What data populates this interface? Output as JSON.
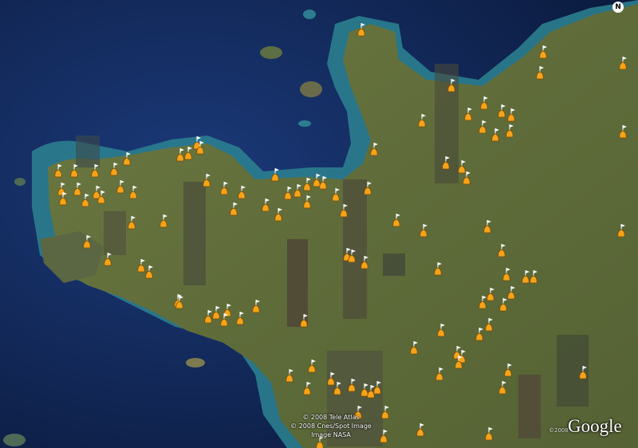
{
  "map": {
    "compass": "N",
    "credits": [
      "© 2008 Tele Atlas",
      "© 2008 Cnes/Spot Image",
      "Image NASA"
    ],
    "logo_year": "©2008",
    "logo": "Google",
    "colors": {
      "sea_deep": "#0d1f4a",
      "sea_shallow": "#2a7a8c",
      "land": "#6b7240",
      "marker_body": "#f5a31a",
      "marker_flag": "#ffffff"
    },
    "marker_icon": "placemark-flag-icon",
    "markers_count_note": ""
  }
}
